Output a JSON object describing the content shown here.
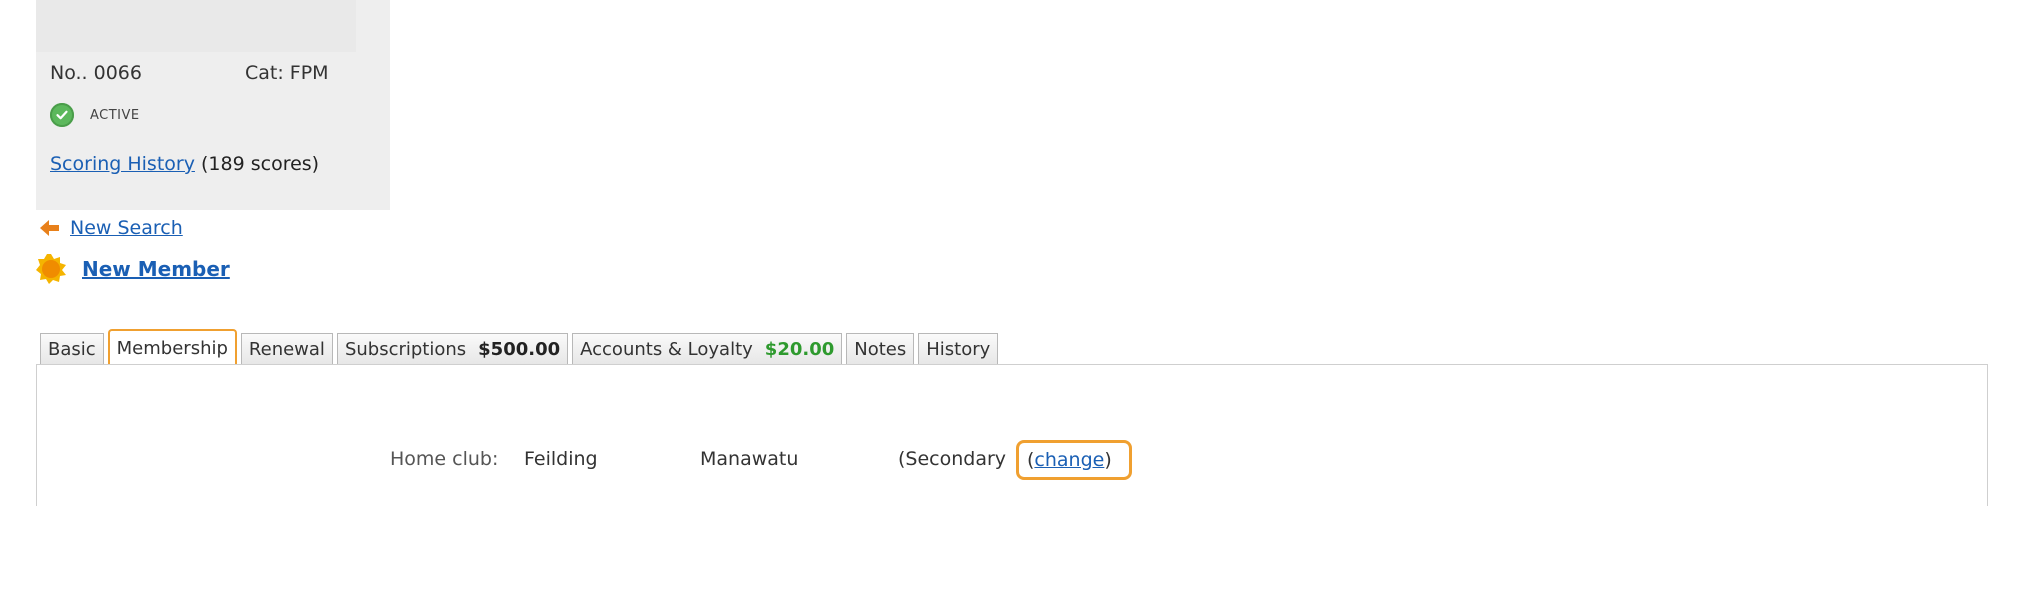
{
  "member": {
    "number": "No.. 0066",
    "category": "Cat: FPM",
    "status": "ACTIVE",
    "scoring_history_link": "Scoring History",
    "scoring_count": "(189 scores)"
  },
  "nav": {
    "new_search": "New Search",
    "new_member": "New Member"
  },
  "tabs": [
    {
      "label": "Basic",
      "amount": ""
    },
    {
      "label": "Membership",
      "amount": ""
    },
    {
      "label": "Renewal",
      "amount": ""
    },
    {
      "label": "Subscriptions",
      "amount": "$500.00"
    },
    {
      "label": "Accounts & Loyalty",
      "amount": "$20.00"
    },
    {
      "label": "Notes",
      "amount": ""
    },
    {
      "label": "History",
      "amount": ""
    }
  ],
  "active_tab": "Membership",
  "membership": {
    "home_club_label": "Home club:",
    "club_name": "Feilding",
    "region": "Manawatu",
    "type": "(Secondary",
    "paren_open": "(",
    "change_link": "change",
    "paren_close": ")"
  },
  "colors": {
    "accent": "#f0a030",
    "link": "#1a5fb4",
    "status_active": "#5cb85c",
    "amount_green": "#2e9a2e"
  },
  "icons": {
    "status": "check-circle-icon",
    "new_search": "left-arrow-icon",
    "new_member": "new-badge-icon"
  }
}
